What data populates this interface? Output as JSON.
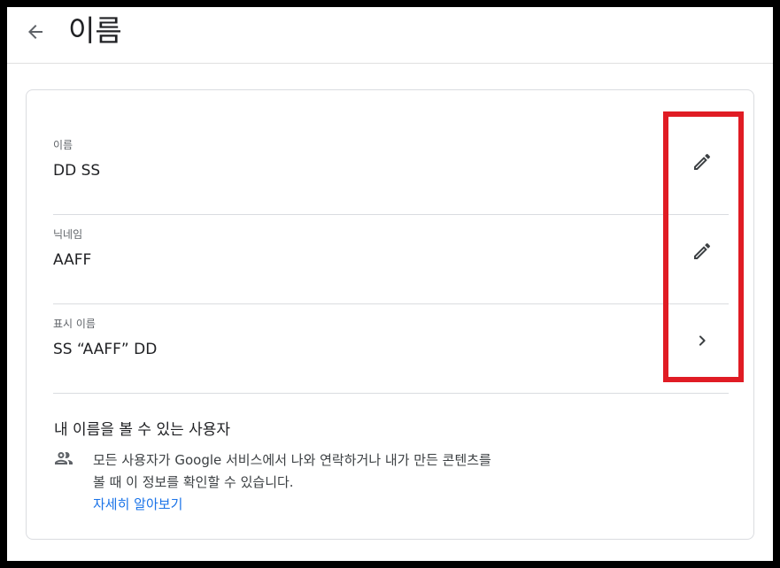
{
  "header": {
    "title": "이름",
    "back_icon": "arrow-left-icon"
  },
  "rows": [
    {
      "label": "이름",
      "value": "DD SS",
      "action_icon": "pencil-icon"
    },
    {
      "label": "닉네임",
      "value": "AAFF",
      "action_icon": "pencil-icon"
    },
    {
      "label": "표시 이름",
      "value": "SS “AAFF” DD",
      "action_icon": "chevron-right-icon"
    }
  ],
  "visibility": {
    "title": "내 이름을 볼 수 있는 사용자",
    "icon": "people-icon",
    "description": "모든 사용자가 Google 서비스에서 나와 연락하거나 내가 만든 콘텐츠를 볼 때 이 정보를 확인할 수 있습니다.",
    "learn_more": "자세히 알아보기"
  },
  "colors": {
    "accent": "#1a73e8",
    "highlight": "#e01c24",
    "divider": "#dadce0"
  }
}
